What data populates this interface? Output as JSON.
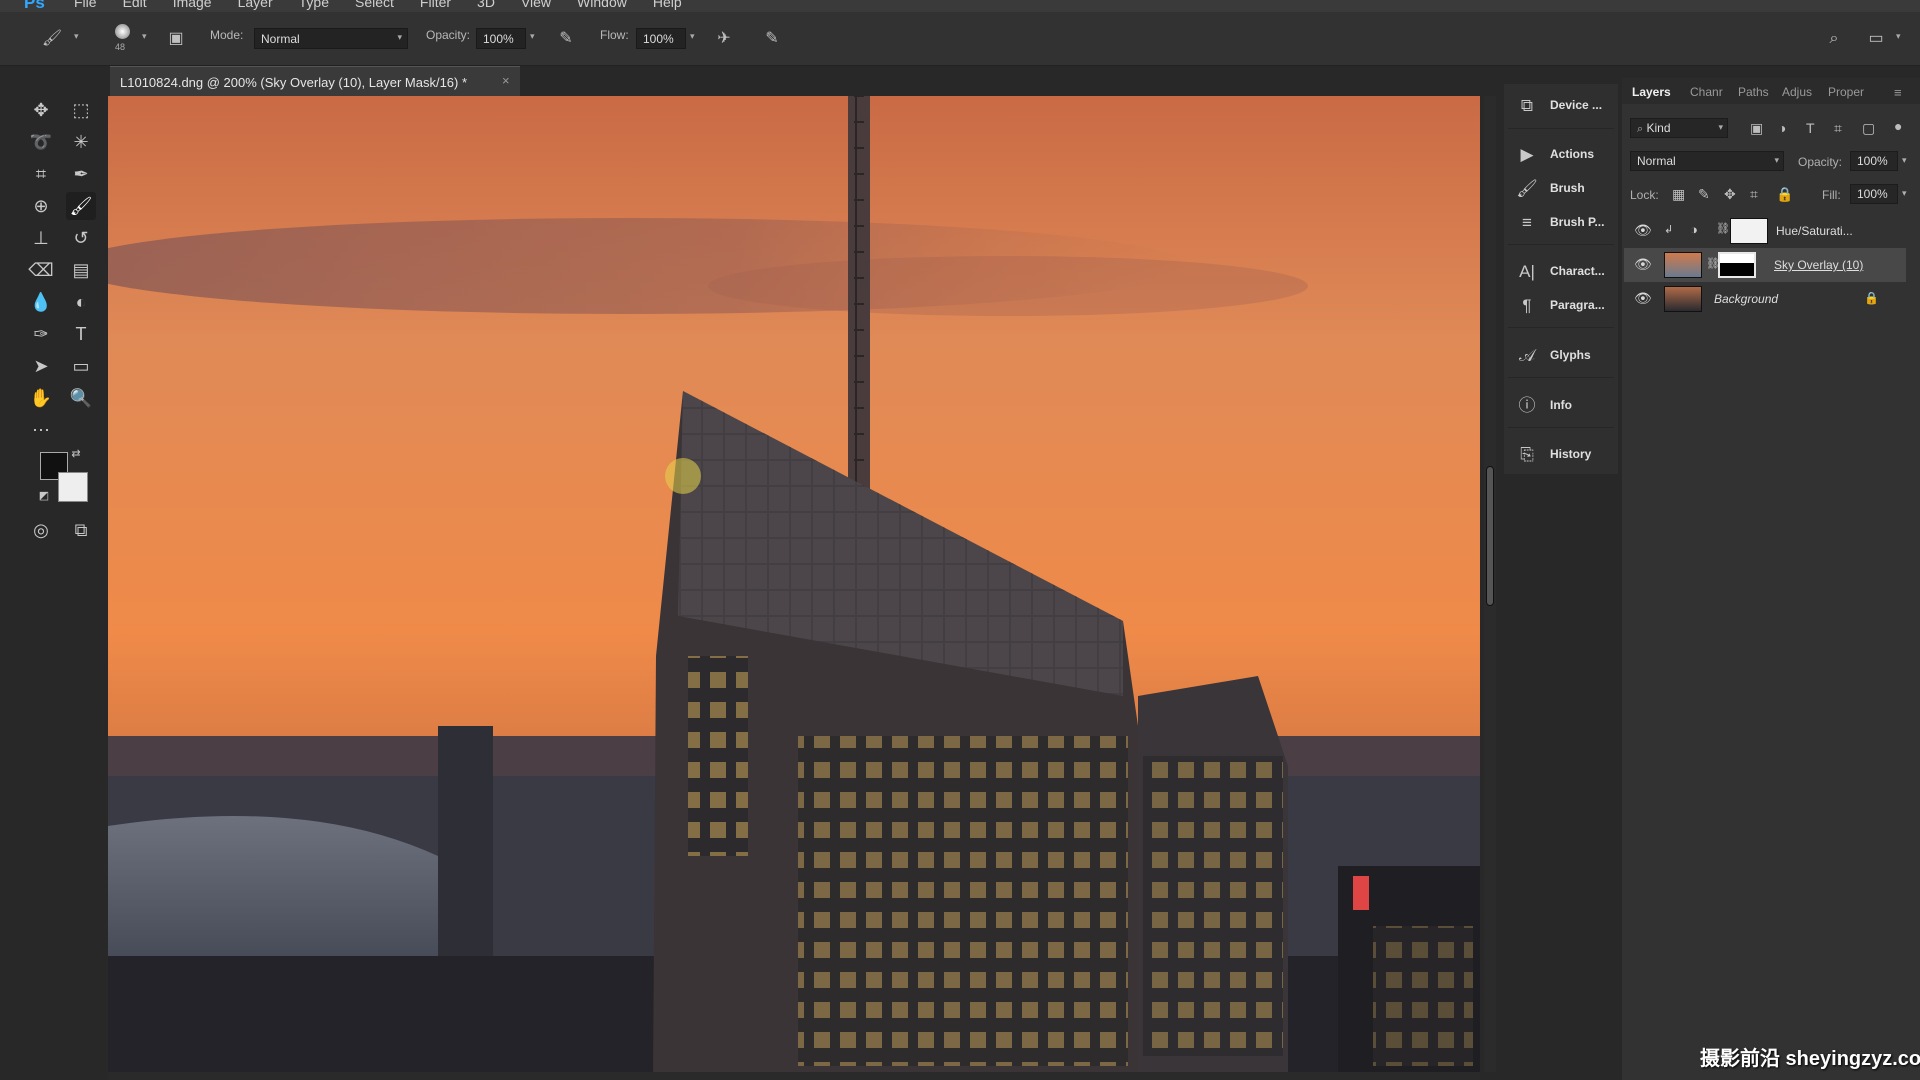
{
  "app": {
    "logo": "Ps"
  },
  "menu": [
    "File",
    "Edit",
    "Image",
    "Layer",
    "Type",
    "Select",
    "Filter",
    "3D",
    "View",
    "Window",
    "Help"
  ],
  "options": {
    "brush_size": "48",
    "mode_label": "Mode:",
    "mode_value": "Normal",
    "opacity_label": "Opacity:",
    "opacity_value": "100%",
    "flow_label": "Flow:",
    "flow_value": "100%"
  },
  "document": {
    "tab_title": "L1010824.dng @ 200% (Sky Overlay (10), Layer Mask/16) *",
    "close": "×"
  },
  "dock": [
    {
      "label": "Device ...",
      "icon": "device-preview-icon",
      "glyph": "⧉"
    },
    {
      "label": "Actions",
      "icon": "play-icon",
      "glyph": "▶"
    },
    {
      "label": "Brush",
      "icon": "brush-icon",
      "glyph": "🖌"
    },
    {
      "label": "Brush P...",
      "icon": "brush-presets-icon",
      "glyph": "≡"
    },
    {
      "label": "Charact...",
      "icon": "character-icon",
      "glyph": "A|"
    },
    {
      "label": "Paragra...",
      "icon": "paragraph-icon",
      "glyph": "¶"
    },
    {
      "label": "Glyphs",
      "icon": "glyphs-icon",
      "glyph": "𝒜"
    },
    {
      "label": "Info",
      "icon": "info-icon",
      "glyph": "ⓘ"
    },
    {
      "label": "History",
      "icon": "history-icon",
      "glyph": "⎘"
    }
  ],
  "layers_panel": {
    "tabs": [
      "Layers",
      "Chanr",
      "Paths",
      "Adjus",
      "Proper"
    ],
    "kind_filter": "Kind",
    "blend_mode": "Normal",
    "opacity_label": "Opacity:",
    "opacity_value": "100%",
    "lock_label": "Lock:",
    "fill_label": "Fill:",
    "fill_value": "100%",
    "layers": [
      {
        "name": "Hue/Saturati...",
        "visible": true,
        "selected": false
      },
      {
        "name": "Sky Overlay (10)",
        "visible": true,
        "selected": true
      },
      {
        "name": "Background",
        "visible": true,
        "selected": false
      }
    ]
  },
  "watermark": "摄影前沿 sheyingzyz.com",
  "colors": {
    "accent": "#31a8ff",
    "foreground_swatch": "#111111",
    "background_swatch": "#eeeeee"
  }
}
